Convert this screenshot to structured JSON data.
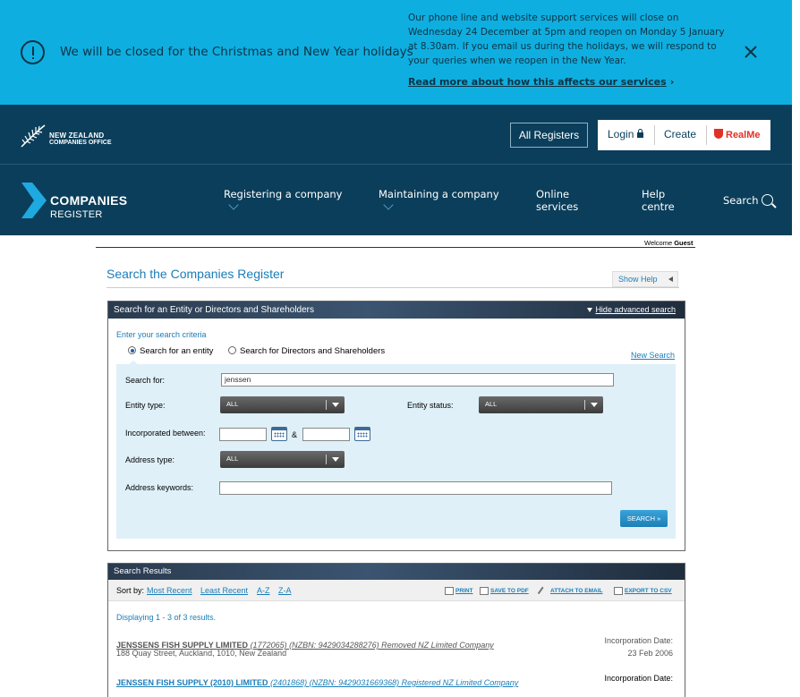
{
  "banner": {
    "headline": "We will be closed for the Christmas and New Year holidays",
    "notice": "Our phone line and website support services will close on Wednesday 24 December at 5pm and reopen on Monday 5 January at 8.30am. If you email us during the holidays, we will respond to your queries when we reopen in the New Year.",
    "read_more": "Read more about how this affects our services"
  },
  "header": {
    "logo_line1": "NEW ZEALAND",
    "logo_line2": "COMPANIES OFFICE",
    "all_registers": "All Registers",
    "login": "Login",
    "create": "Create",
    "realme": "RealMe"
  },
  "nav": {
    "logo_line1": "COMPANIES",
    "logo_line2": "REGISTER",
    "items": [
      {
        "label": "Registering a company"
      },
      {
        "label": "Maintaining a company"
      },
      {
        "label": "Online services"
      },
      {
        "label": "Help centre"
      }
    ],
    "search": "Search"
  },
  "welcome": {
    "prefix": "Welcome",
    "user": "Guest"
  },
  "page": {
    "title": "Search the Companies Register",
    "show_help": "Show Help"
  },
  "search_panel": {
    "heading": "Search for an Entity or Directors and Shareholders",
    "hide_advanced": "Hide advanced search",
    "criteria": "Enter your search criteria",
    "radio_entity": "Search for an entity",
    "radio_directors": "Search for Directors and Shareholders",
    "new_search": "New Search",
    "search_for_label": "Search for:",
    "search_for_value": "jenssen",
    "entity_type_label": "Entity type:",
    "entity_type_value": "ALL",
    "entity_status_label": "Entity status:",
    "entity_status_value": "ALL",
    "incorporated_label": "Incorporated between:",
    "amp": "&",
    "address_type_label": "Address type:",
    "address_type_value": "ALL",
    "address_keywords_label": "Address keywords:",
    "search_button": "SEARCH »"
  },
  "results": {
    "heading": "Search Results",
    "sort_by": "Sort by:",
    "sorts": [
      "Most Recent",
      "Least Recent",
      "A-Z",
      "Z-A"
    ],
    "actions": [
      "PRINT",
      "SAVE TO PDF",
      "ATTACH TO EMAIL",
      "EXPORT TO CSV"
    ],
    "displaying": "Displaying 1 - 3 of 3 results.",
    "rows": [
      {
        "name": "JENSSENS FISH SUPPLY LIMITED",
        "details": "(1772065) (NZBN: 9429034288276) Removed NZ Limited Company",
        "address": "188 Quay Street, Auckland, 1010, New Zealand",
        "inc_label": "Incorporation Date:",
        "inc_date": "23 Feb 2006"
      },
      {
        "name": "JENSSEN FISH SUPPLY (2010) LIMITED",
        "details": "(2401868) (NZBN: 9429031669368) Registered NZ Limited Company",
        "address": "",
        "inc_label": "Incorporation Date:",
        "inc_date": ""
      }
    ]
  }
}
